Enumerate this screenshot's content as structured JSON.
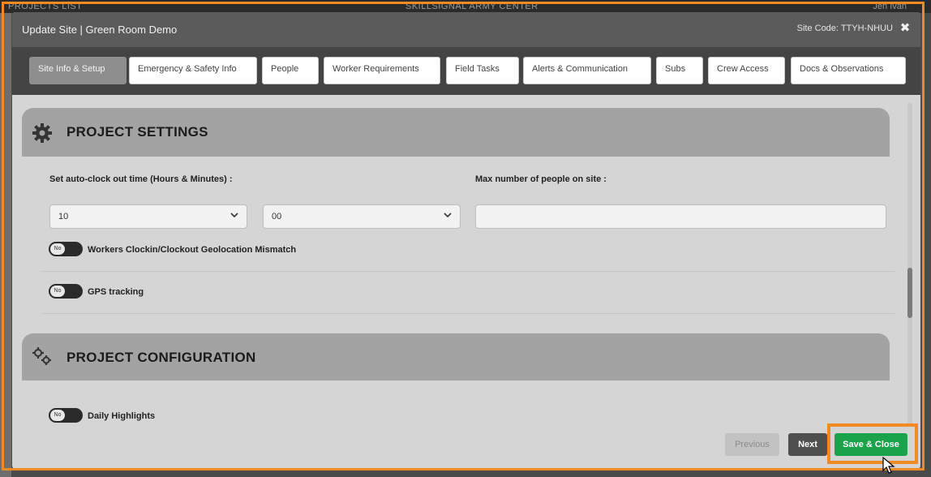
{
  "background": {
    "left_text": "PROJECTS LIST",
    "center_text": "SKILLSIGNAL ARMY CENTER",
    "right_text": "Jen Ivan"
  },
  "modal": {
    "title": "Update Site | Green Room Demo",
    "site_code": "Site Code: TTYH-NHUU",
    "close_icon": "close-icon"
  },
  "tabs": [
    {
      "label": "Site Info & Setup",
      "active": true
    },
    {
      "label": "Emergency & Safety Info",
      "active": false
    },
    {
      "label": "People",
      "active": false
    },
    {
      "label": "Worker Requirements",
      "active": false
    },
    {
      "label": "Field Tasks",
      "active": false
    },
    {
      "label": "Alerts & Communication",
      "active": false
    },
    {
      "label": "Subs",
      "active": false
    },
    {
      "label": "Crew Access",
      "active": false
    },
    {
      "label": "Docs & Observations",
      "active": false
    }
  ],
  "project_settings": {
    "title": "PROJECT SETTINGS",
    "icon": "gear-icon",
    "auto_clock_label": "Set auto-clock out time (Hours & Minutes) :",
    "hours_value": "10",
    "minutes_value": "00",
    "max_people_label": "Max number of people on site :",
    "max_people_value": "",
    "geolocation_toggle": {
      "state": "No",
      "label": "Workers Clockin/Clockout Geolocation Mismatch"
    },
    "gps_toggle": {
      "state": "No",
      "label": "GPS tracking"
    }
  },
  "project_configuration": {
    "title": "PROJECT CONFIGURATION",
    "icon": "gears-icon",
    "daily_highlights_toggle": {
      "state": "No",
      "label": "Daily Highlights"
    }
  },
  "footer": {
    "previous_label": "Previous",
    "next_label": "Next",
    "save_label": "Save & Close"
  },
  "colors": {
    "accent_highlight": "#f08a24",
    "save_green": "#1aa34a",
    "header_gray": "#5b5b5b",
    "tabbar_dark": "#444444"
  }
}
